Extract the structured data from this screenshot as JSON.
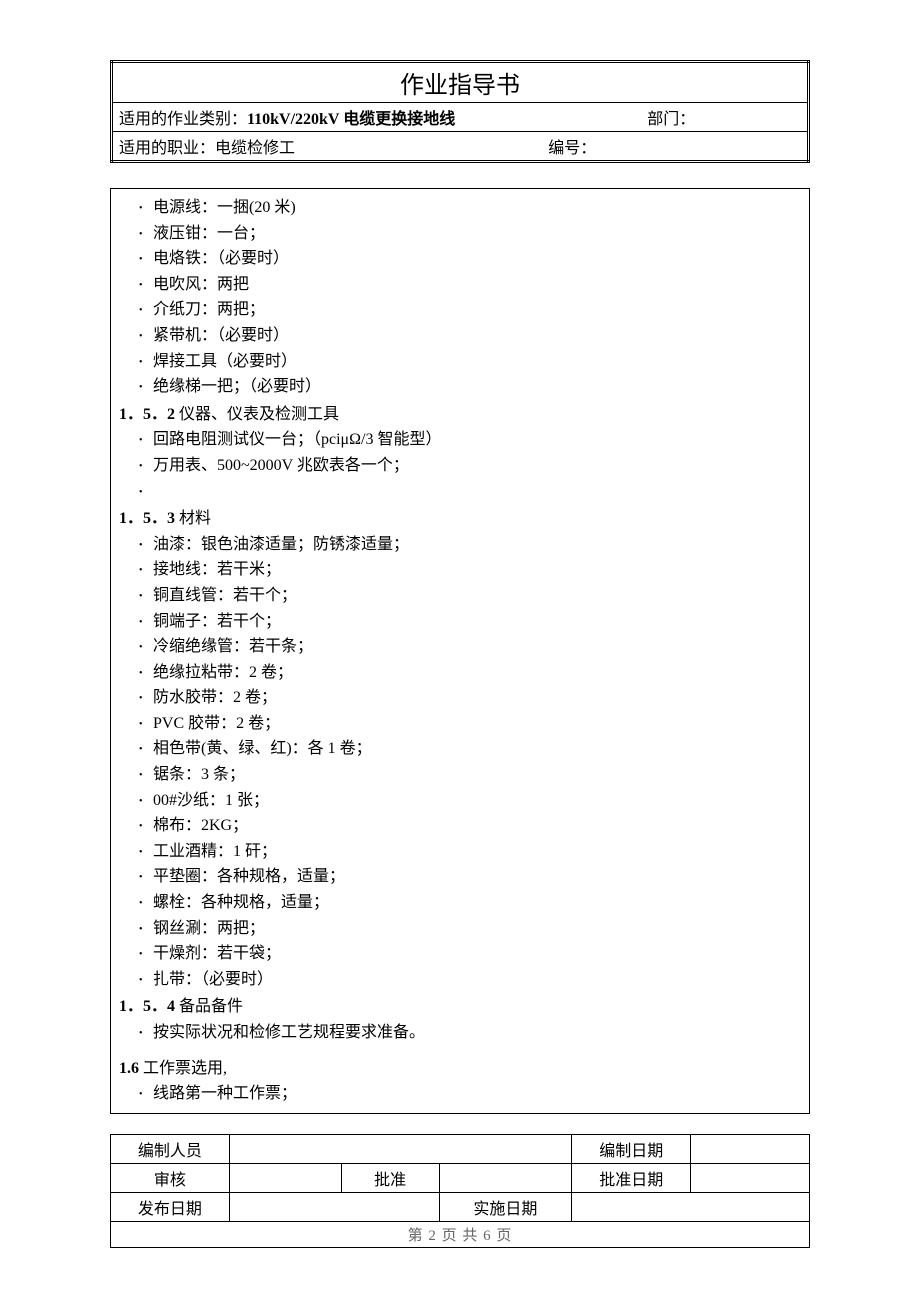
{
  "header": {
    "title": "作业指导书",
    "scope_label": "适用的作业类别：",
    "scope_value": "110kV/220kV 电缆更换接地线",
    "dept_label": "部门：",
    "occupation_label": "适用的职业：",
    "occupation_value": "电缆检修工",
    "number_label": "编号："
  },
  "sections": {
    "list1": [
      "电源线：一捆(20 米)",
      "液压钳：一台；",
      "电烙铁：（必要时）",
      "电吹风：两把",
      "介纸刀：两把；",
      "紧带机：（必要时）",
      "焊接工具（必要时）",
      "绝缘梯一把；（必要时）"
    ],
    "s152": {
      "heading_num": "1．5．2",
      "heading_txt": " 仪器、仪表及检测工具",
      "items": [
        "回路电阻测试仪一台；（pciμΩ/3 智能型）",
        "万用表、500~2000V 兆欧表各一个；"
      ]
    },
    "s153": {
      "heading_num": "1．5．3",
      "heading_txt": " 材料",
      "items": [
        "油漆：银色油漆适量；防锈漆适量；",
        "接地线：若干米；",
        "铜直线管：若干个；",
        "铜端子：若干个；",
        "冷缩绝缘管：若干条；",
        "绝缘拉粘带：2 卷；",
        "防水胶带：2 卷；",
        "PVC 胶带：2 卷；",
        "相色带(黄、绿、红)：各 1 卷；",
        "锯条：3 条；",
        "00#沙纸：1 张；",
        "棉布：2KG；",
        "工业酒精：1 矸；",
        "平垫圈：各种规格，适量；",
        "螺栓：各种规格，适量；",
        "钢丝涮：两把；",
        "干燥剂：若干袋；",
        "扎带：（必要时）"
      ]
    },
    "s154": {
      "heading_num": "1．5．4",
      "heading_txt": " 备品备件",
      "items": [
        "按实际状况和检修工艺规程要求准备。"
      ]
    },
    "s16": {
      "heading_num": "1.6",
      "heading_txt": " 工作票选用,",
      "items": [
        "线路第一种工作票；"
      ]
    }
  },
  "footer": {
    "author_label": "编制人员",
    "author_date_label": "编制日期",
    "review_label": "审核",
    "approve_label": "批准",
    "approve_date_label": "批准日期",
    "publish_date_label": "发布日期",
    "impl_date_label": "实施日期",
    "page_info": "第 2 页 共 6 页"
  }
}
